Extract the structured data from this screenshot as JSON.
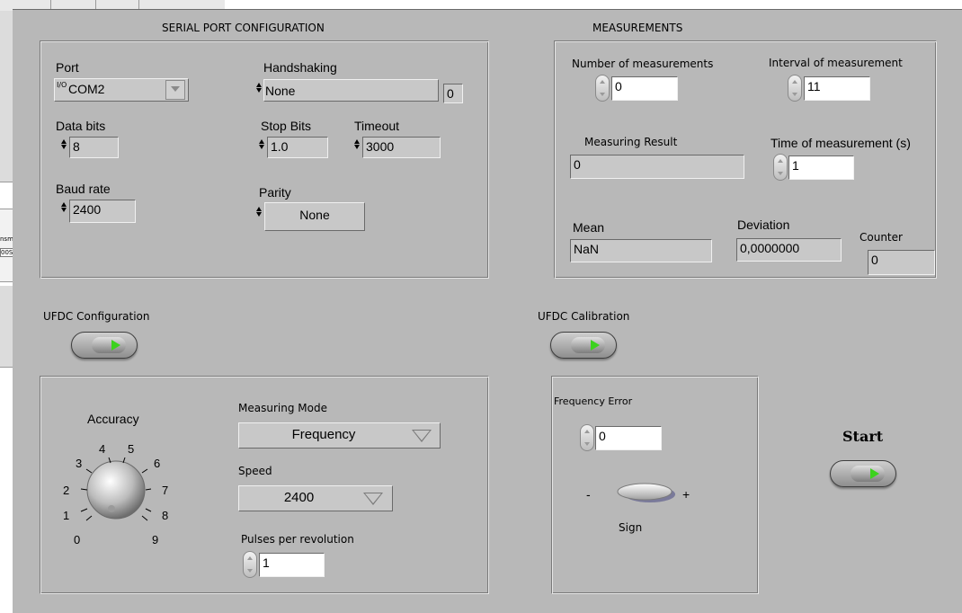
{
  "left_strip": {
    "partial_label_top": "nsmi",
    "partial_label_bottom": "00S"
  },
  "serial_config": {
    "title": "SERIAL PORT CONFIGURATION",
    "port_label": "Port",
    "port_prefix": "I/O",
    "port_value": "COM2",
    "handshaking_label": "Handshaking",
    "handshaking_value": "None",
    "handshaking_index": "0",
    "data_bits_label": "Data bits",
    "data_bits_value": "8",
    "stop_bits_label": "Stop Bits",
    "stop_bits_value": "1.0",
    "timeout_label": "Timeout",
    "timeout_value": "3000",
    "baud_rate_label": "Baud rate",
    "baud_rate_value": "2400",
    "parity_label": "Parity",
    "parity_value": "None"
  },
  "measurements": {
    "title": "MEASUREMENTS",
    "num_label": "Number of measurements",
    "num_value": "0",
    "interval_label": "Interval of measurement",
    "interval_value": "11",
    "result_label": "Measuring Result",
    "result_value": "0",
    "time_label": "Time of measurement (s)",
    "time_value": "1",
    "mean_label": "Mean",
    "mean_value": "NaN",
    "deviation_label": "Deviation",
    "deviation_value": "0,0000000",
    "counter_label": "Counter",
    "counter_value": "0"
  },
  "ufdc_config": {
    "label": "UFDC Configuration",
    "accuracy_label": "Accuracy",
    "dial_ticks": [
      "0",
      "1",
      "2",
      "3",
      "4",
      "5",
      "6",
      "7",
      "8",
      "9"
    ],
    "mode_label": "Measuring Mode",
    "mode_value": "Frequency",
    "speed_label": "Speed",
    "speed_value": "2400",
    "pulses_label": "Pulses per revolution",
    "pulses_value": "1"
  },
  "ufdc_calibration": {
    "label": "UFDC Calibration",
    "freq_error_label": "Frequency Error",
    "freq_error_value": "0",
    "sign_minus": "-",
    "sign_plus": "+",
    "sign_label": "Sign"
  },
  "start": {
    "label": "Start"
  },
  "colors": {
    "panel": "#b8b8b8",
    "led_green": "#3cd21e"
  }
}
